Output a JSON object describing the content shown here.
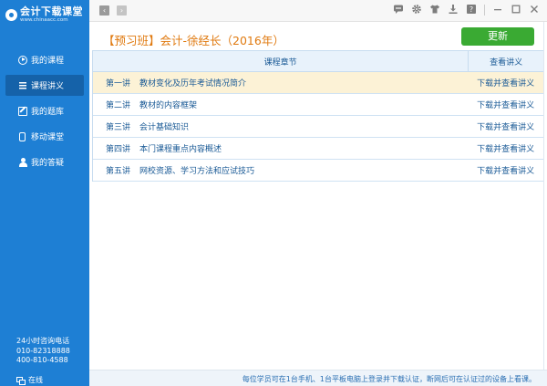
{
  "app": {
    "logo_title": "会计下载课堂",
    "logo_sub": "www.chinaacc.com"
  },
  "sidebar": {
    "items": [
      {
        "label": "我的课程",
        "icon": "play-circle-icon"
      },
      {
        "label": "课程讲义",
        "icon": "list-icon",
        "active": true
      },
      {
        "label": "我的题库",
        "icon": "edit-icon"
      },
      {
        "label": "移动课堂",
        "icon": "phone-icon"
      },
      {
        "label": "我的答疑",
        "icon": "user-icon"
      }
    ],
    "contact_label": "24小时咨询电话",
    "phone1": "010-82318888",
    "phone2": "400-810-4588",
    "status": "在线"
  },
  "toolbar": {
    "back": "‹",
    "forward": "›",
    "icons": [
      "message-icon",
      "gear-icon",
      "shirt-icon",
      "download-icon",
      "help-icon",
      "minimize-icon",
      "maximize-icon",
      "close-icon"
    ]
  },
  "header": {
    "title": "【预习班】会计-徐经长（2016年）",
    "refresh_label": "更新"
  },
  "table": {
    "col_chapter": "课程章节",
    "col_action": "查看讲义",
    "rows": [
      {
        "no": "第一讲",
        "name": "教材变化及历年考试情况简介",
        "action": "下载并查看讲义"
      },
      {
        "no": "第二讲",
        "name": "教材的内容框架",
        "action": "下载并查看讲义"
      },
      {
        "no": "第三讲",
        "name": "会计基础知识",
        "action": "下载并查看讲义"
      },
      {
        "no": "第四讲",
        "name": "本门课程重点内容概述",
        "action": "下载并查看讲义"
      },
      {
        "no": "第五讲",
        "name": "网校资源、学习方法和应试技巧",
        "action": "下载并查看讲义"
      }
    ]
  },
  "footer": {
    "note": "每位学员可在1台手机、1台平板电脑上登录并下载认证，断网后可在认证过的设备上看课。"
  },
  "colors": {
    "sidebar": "#1e7fd4",
    "sidebar_active": "#1562a9",
    "accent_title": "#e07a10",
    "button_green": "#3aaa33",
    "row_highlight": "#fcf2d6"
  }
}
